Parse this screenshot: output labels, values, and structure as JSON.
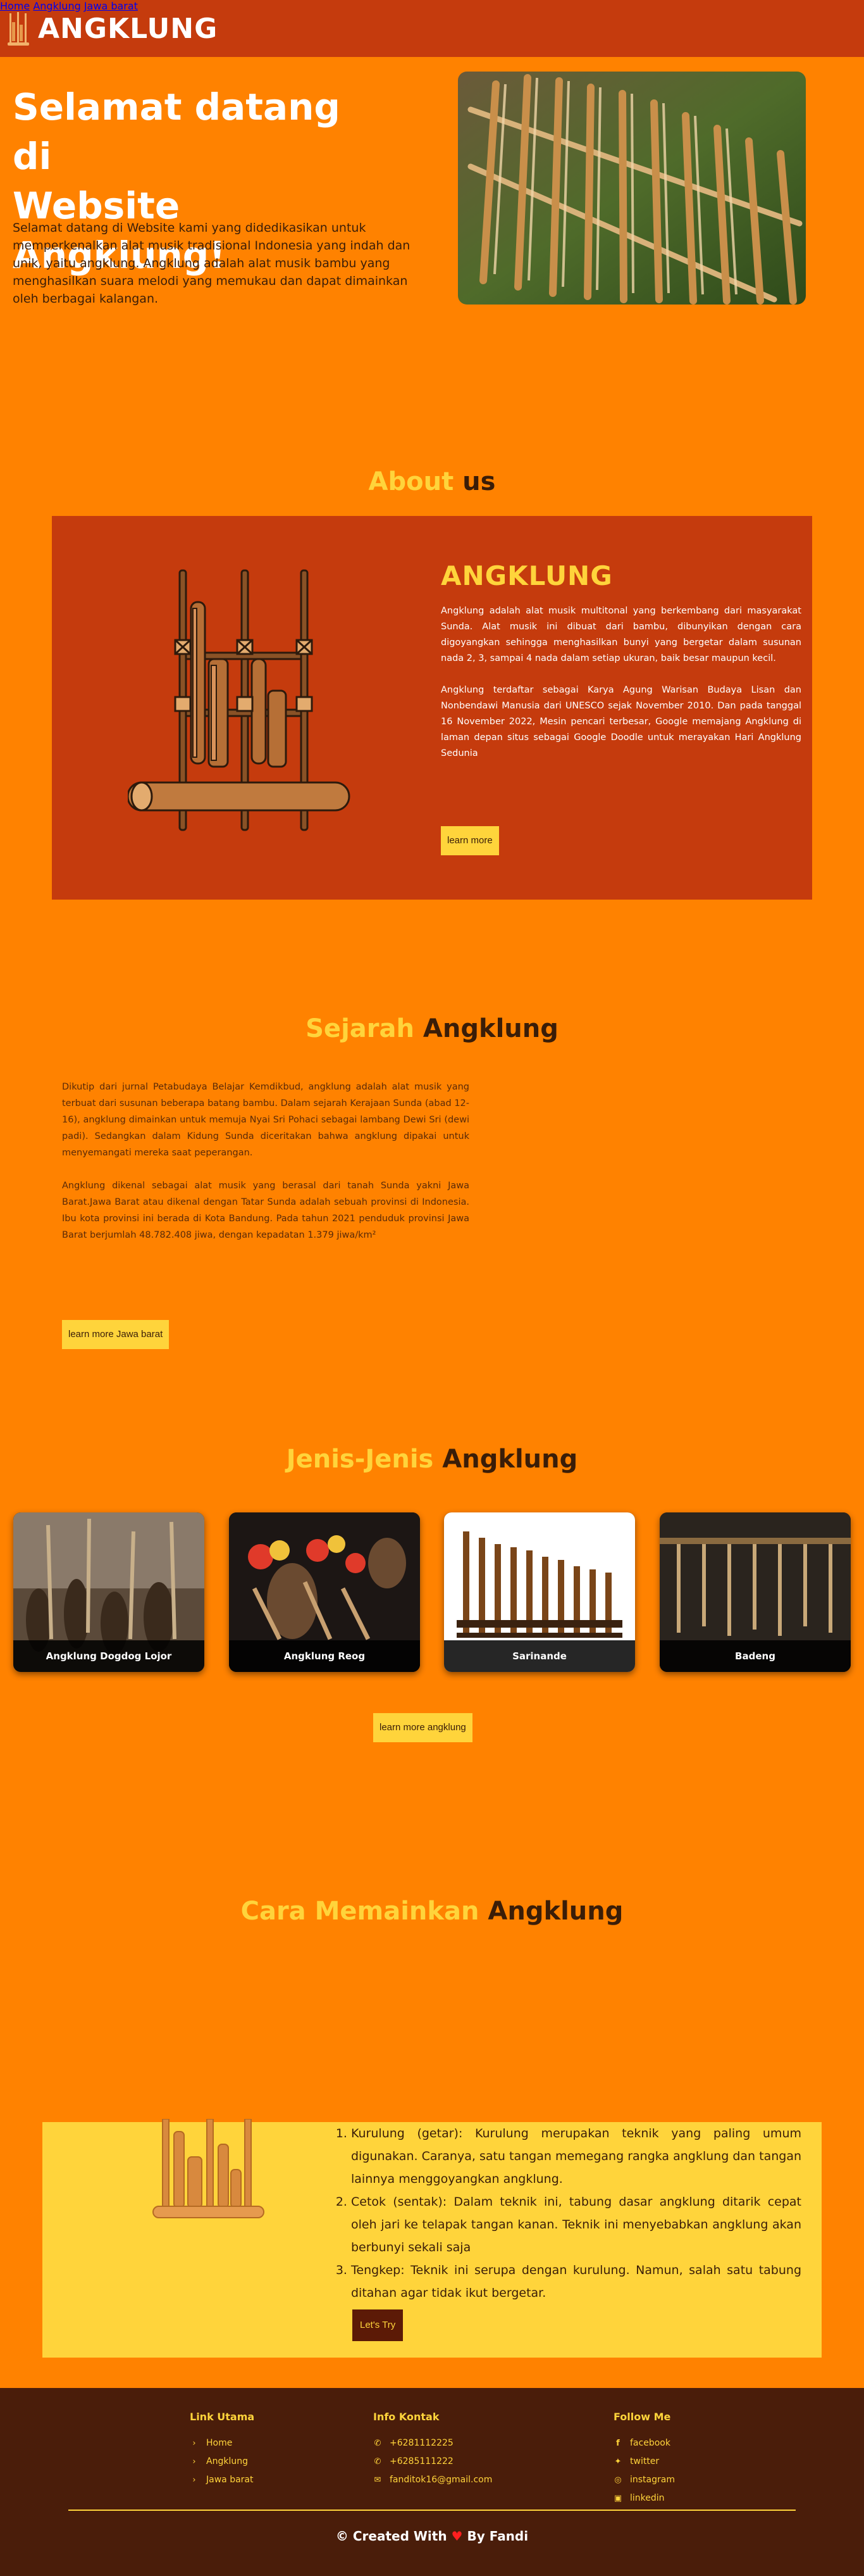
{
  "header": {
    "logo_text": "ANGKLUNG",
    "nav": [
      "Home",
      "Angklung",
      "Jawa barat"
    ]
  },
  "hero": {
    "title_line1": "Selamat datang di",
    "title_line2": "Website Angklung!",
    "text": "Selamat datang di Website kami yang didedikasikan untuk memperkenalkan alat musik tradisional Indonesia yang indah dan unik, yaitu angklung. Angklung adalah alat musik bambu yang menghasilkan suara melodi yang memukau dan dapat dimainkan oleh berbagai kalangan."
  },
  "about": {
    "title_a": "About",
    "title_b": "us",
    "heading": "ANGKLUNG",
    "p1": "Angklung adalah alat musik multitonal yang berkembang dari masyarakat Sunda. Alat musik ini dibuat dari bambu, dibunyikan dengan cara digoyangkan sehingga menghasilkan bunyi yang bergetar dalam susunan nada 2, 3, sampai 4 nada dalam setiap ukuran, baik besar maupun kecil.",
    "p2": "Angklung terdaftar sebagai Karya Agung Warisan Budaya Lisan dan Nonbendawi Manusia dari UNESCO sejak November 2010. Dan pada tanggal 16 November 2022, Mesin pencari terbesar, Google memajang Angklung di laman depan situs sebagai Google Doodle untuk merayakan Hari Angklung Sedunia",
    "button": "learn more"
  },
  "sejarah": {
    "title_a": "Sejarah",
    "title_b": "Angklung",
    "p1": "Dikutip dari jurnal Petabudaya Belajar Kemdikbud, angklung adalah alat musik yang terbuat dari susunan beberapa batang bambu. Dalam sejarah Kerajaan Sunda (abad 12-16), angklung dimainkan untuk memuja Nyai Sri Pohaci sebagai lambang Dewi Sri (dewi padi). Sedangkan dalam Kidung Sunda diceritakan bahwa angklung dipakai untuk menyemangati mereka saat peperangan.",
    "p2": "Angklung dikenal sebagai alat musik yang berasal dari tanah Sunda yakni Jawa Barat.Jawa Barat atau dikenal dengan Tatar Sunda adalah sebuah provinsi di Indonesia. Ibu kota provinsi ini berada di Kota Bandung. Pada tahun 2021 penduduk provinsi Jawa Barat berjumlah 48.782.408 jiwa, dengan kepadatan 1.379 jiwa/km²",
    "button": "learn more Jawa barat"
  },
  "jenis": {
    "title_a": "Jenis-Jenis",
    "title_b": "Angklung",
    "cards": [
      "Angklung Dogdog Lojor",
      "Angklung Reog",
      "Sarinande",
      "Badeng"
    ],
    "button": "learn more angklung"
  },
  "cara": {
    "title_a": "Cara Memainkan",
    "title_b": "Angklung",
    "steps": [
      "Kurulung (getar): Kurulung merupakan teknik yang paling umum digunakan. Caranya, satu tangan memegang rangka angklung dan tangan lainnya menggoyangkan angklung.",
      "Cetok (sentak): Dalam teknik ini, tabung dasar angklung ditarik cepat oleh jari ke telapak tangan kanan. Teknik ini menyebabkan angklung akan berbunyi sekali saja",
      "Tengkep: Teknik ini serupa dengan kurulung. Namun, salah satu tabung ditahan agar tidak ikut bergetar."
    ],
    "button": "Let's Try"
  },
  "footer": {
    "col1_title": "Link Utama",
    "col1_items": [
      "Home",
      "Angklung",
      "Jawa barat"
    ],
    "col2_title": "Info Kontak",
    "col2_items": [
      "+6281112225",
      "+6285111222",
      "fanditok16@gmail.com"
    ],
    "col3_title": "Follow Me",
    "col3_items": [
      "facebook",
      "twitter",
      "instagram",
      "linkedin"
    ],
    "copy_a": "© Created With",
    "copy_b": "By Fandi"
  },
  "colors": {
    "orange": "#ff8200",
    "red_brown": "#c53b0d",
    "yellow": "#ffd43b",
    "dark_brown": "#4a1d0a"
  }
}
